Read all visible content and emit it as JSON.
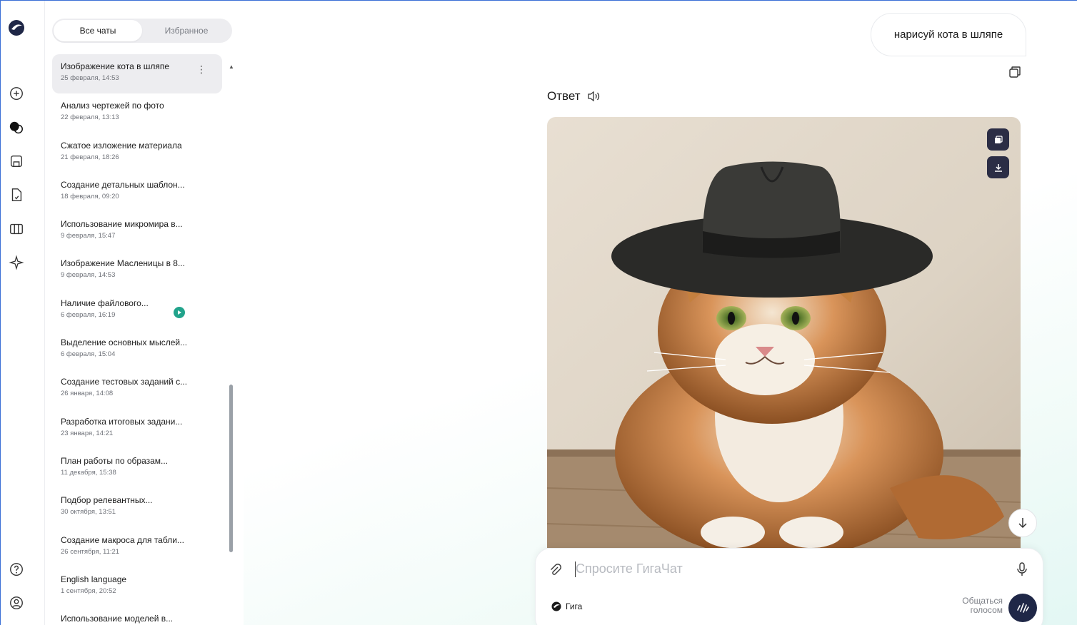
{
  "sidebar": {
    "tabs": [
      {
        "label": "Все чаты",
        "active": true
      },
      {
        "label": "Избранное",
        "active": false
      }
    ],
    "rail_icons": [
      "logo-icon",
      "new-chat-icon",
      "chats-icon",
      "saved-icon",
      "files-icon",
      "library-icon",
      "sparkle-icon",
      "help-icon",
      "profile-icon"
    ],
    "chats": [
      {
        "title": "Изображение кота в шляпе",
        "date": "25 февраля, 14:53"
      },
      {
        "title": "Анализ чертежей по фото",
        "date": "22 февраля, 13:13"
      },
      {
        "title": "Сжатое изложение материала",
        "date": "21 февраля, 18:26"
      },
      {
        "title": "Создание детальных шаблон...",
        "date": "18 февраля, 09:20"
      },
      {
        "title": "Использование микромира в...",
        "date": "9 февраля, 15:47"
      },
      {
        "title": "Изображение Масленицы в 8...",
        "date": "9 февраля, 14:53"
      },
      {
        "title": "Наличие файлового...",
        "date": "6 февраля, 16:19"
      },
      {
        "title": "Выделение основных мыслей...",
        "date": "6 февраля, 15:04"
      },
      {
        "title": "Создание тестовых заданий с...",
        "date": "26 января, 14:08"
      },
      {
        "title": "Разработка итоговых задани...",
        "date": "23 января, 14:21"
      },
      {
        "title": "План работы по образам...",
        "date": "11 декабря, 15:38"
      },
      {
        "title": "Подбор релевантных...",
        "date": "30 октября, 13:51"
      },
      {
        "title": "Создание макроса для табли...",
        "date": "26 сентября, 11:21"
      },
      {
        "title": "English language",
        "date": "1 сентября, 20:52"
      },
      {
        "title": "Использование моделей в...",
        "date": ""
      }
    ]
  },
  "chat": {
    "user_message": "нарисуй кота в шляпе",
    "answer_label": "Ответ"
  },
  "composer": {
    "placeholder": "Спросите ГигаЧат",
    "model_label": "Гига",
    "voice_label_line1": "Общаться",
    "voice_label_line2": "голосом"
  },
  "colors": {
    "accent_dark": "#1f2747",
    "play_green": "#21a38b",
    "selected_bg": "#ededf0"
  }
}
